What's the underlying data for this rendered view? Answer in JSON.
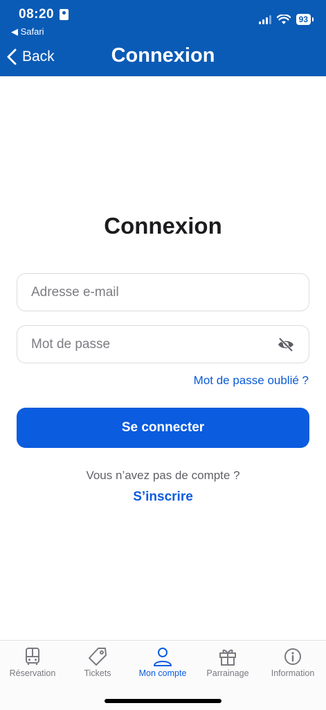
{
  "status_bar": {
    "time": "08:20",
    "back_app": "◀ Safari",
    "battery": "93"
  },
  "header": {
    "back_label": "Back",
    "title": "Connexion"
  },
  "main": {
    "title": "Connexion",
    "email_placeholder": "Adresse e-mail",
    "password_placeholder": "Mot de passe",
    "forgot_password": "Mot de passe oublié ?",
    "login_button": "Se connecter",
    "no_account_text": "Vous n’avez pas de compte ?",
    "signup_link": "S’inscrire"
  },
  "tabbar": {
    "tabs": [
      {
        "label": "Réservation",
        "icon": "bus-icon"
      },
      {
        "label": "Tickets",
        "icon": "tag-icon"
      },
      {
        "label": "Mon compte",
        "icon": "person-icon",
        "active": true
      },
      {
        "label": "Parrainage",
        "icon": "gift-icon"
      },
      {
        "label": "Information",
        "icon": "info-icon"
      }
    ]
  },
  "colors": {
    "header_bg": "#0a5bb6",
    "accent": "#0b5cde",
    "inactive_tab": "#7a7a80"
  }
}
